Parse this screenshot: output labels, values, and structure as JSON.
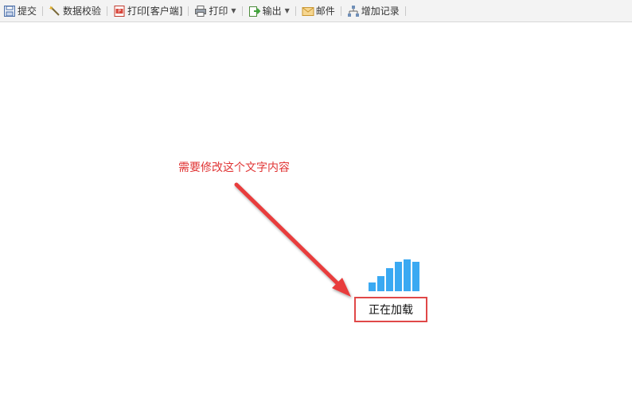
{
  "toolbar": {
    "items": [
      {
        "label": "提交",
        "icon": "save-icon"
      },
      {
        "label": "数据校验",
        "icon": "wand-icon"
      },
      {
        "label": "打印[客户端]",
        "icon": "pdf-print-icon"
      },
      {
        "label": "打印",
        "icon": "printer-icon",
        "dropdown": true
      },
      {
        "label": "输出",
        "icon": "export-icon",
        "dropdown": true
      },
      {
        "label": "邮件",
        "icon": "mail-icon"
      },
      {
        "label": "增加记录",
        "icon": "add-record-icon"
      }
    ]
  },
  "annotation": {
    "text": "需要修改这个文字内容",
    "color": "#e03434"
  },
  "loading": {
    "text": "正在加载",
    "bar_color": "#3aa9f2",
    "highlight_color": "#e04848"
  }
}
